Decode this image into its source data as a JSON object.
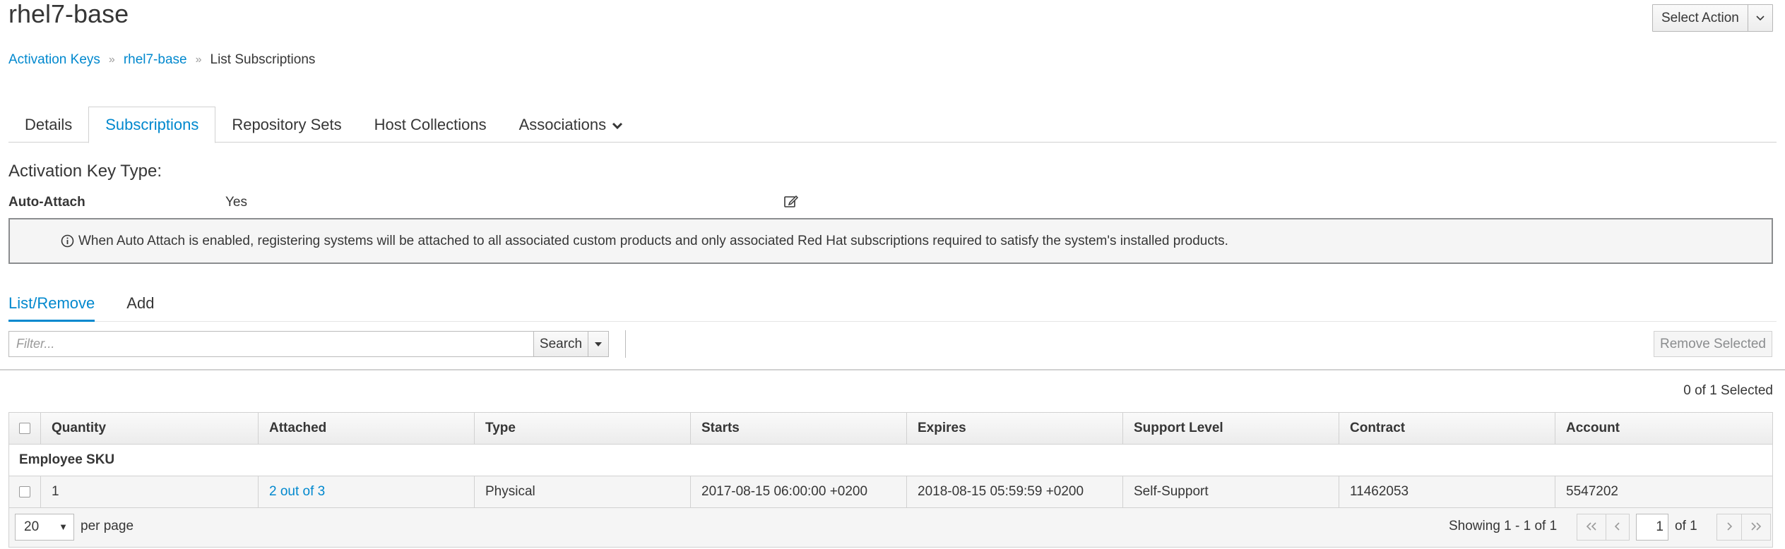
{
  "header": {
    "title": "rhel7-base",
    "select_action_label": "Select Action"
  },
  "breadcrumb": {
    "items": [
      "Activation Keys",
      "rhel7-base"
    ],
    "current": "List Subscriptions"
  },
  "tabs": [
    {
      "label": "Details"
    },
    {
      "label": "Subscriptions",
      "active": true
    },
    {
      "label": "Repository Sets"
    },
    {
      "label": "Host Collections"
    },
    {
      "label": "Associations"
    }
  ],
  "activation_key": {
    "type_heading": "Activation Key Type:",
    "auto_attach_label": "Auto-Attach",
    "auto_attach_value": "Yes",
    "info_text": "When Auto Attach is enabled, registering systems will be attached to all associated custom products and only associated Red Hat subscriptions required to satisfy the system's installed products."
  },
  "subtabs": [
    {
      "label": "List/Remove",
      "active": true
    },
    {
      "label": "Add"
    }
  ],
  "toolbar": {
    "filter_placeholder": "Filter...",
    "search_label": "Search",
    "remove_selected_label": "Remove Selected"
  },
  "selected_count": "0 of 1 Selected",
  "table": {
    "columns": [
      "Quantity",
      "Attached",
      "Type",
      "Starts",
      "Expires",
      "Support Level",
      "Contract",
      "Account"
    ],
    "group": "Employee SKU",
    "rows": [
      {
        "quantity": "1",
        "attached": "2 out of 3",
        "type": "Physical",
        "starts": "2017-08-15 06:00:00 +0200",
        "expires": "2018-08-15 05:59:59 +0200",
        "support_level": "Self-Support",
        "contract": "11462053",
        "account": "5547202"
      }
    ]
  },
  "pagination": {
    "per_page_value": "20",
    "per_page_label": "per page",
    "showing": "Showing 1 - 1 of 1",
    "current_page": "1",
    "of_pages": "of 1"
  },
  "colors": {
    "link": "#0088ce",
    "text": "#363636",
    "border": "#d1d1d1"
  }
}
